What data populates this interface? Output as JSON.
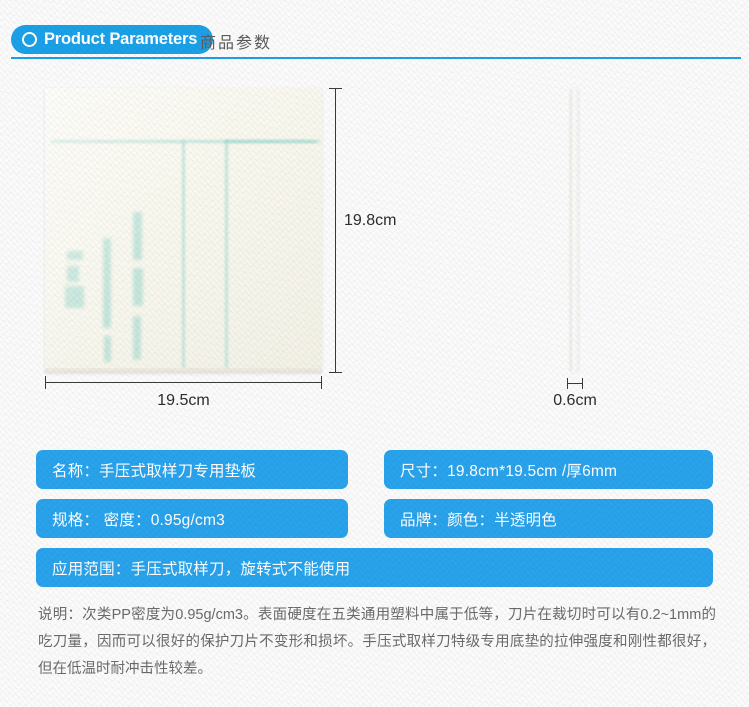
{
  "header": {
    "badge_label": "Product Parameters",
    "badge_icon": "circle-ring-icon",
    "title_cn": "商品参数",
    "accent_color": "#1ba1e8"
  },
  "figure": {
    "front_view_alt": "translucent-cutting-mat-front-view",
    "side_view_alt": "cutting-mat-side-thickness-view",
    "dim_height": "19.8cm",
    "dim_width": "19.5cm",
    "dim_thickness": "0.6cm"
  },
  "specs": {
    "bar_color": "#29a3ec",
    "rows": [
      {
        "left": "名称：手压式取样刀专用垫板",
        "right": "尺寸：19.8cm*19.5cm /厚6mm"
      },
      {
        "left": "规格： 密度：0.95g/cm3",
        "right": "品牌：颜色：半透明色"
      }
    ],
    "full": "应用范围：手压式取样刀，旋转式不能使用"
  },
  "description": {
    "text": "说明：次类PP密度为0.95g/cm3。表面硬度在五类通用塑料中属于低等，刀片在裁切时可以有0.2~1mm的吃刀量，因而可以很好的保护刀片不变形和损坏。手压式取样刀特级专用底垫的拉伸强度和刚性都很好，但在低温时耐冲击性较差。"
  }
}
